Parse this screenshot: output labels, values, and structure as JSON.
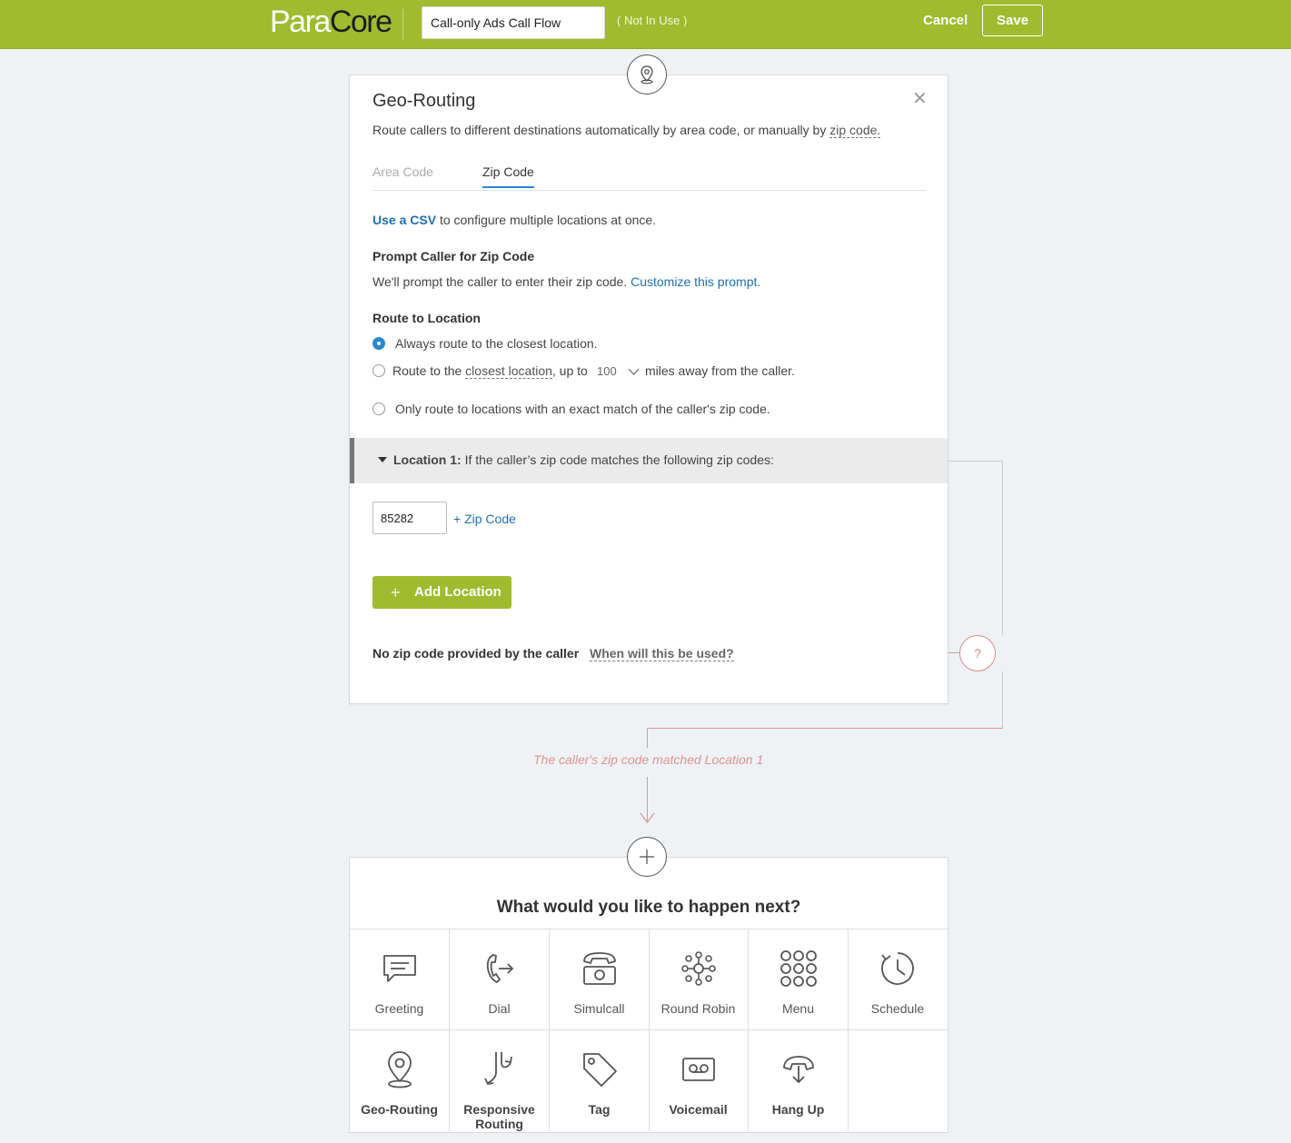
{
  "header": {
    "logo_light": "Para",
    "logo_dark": "Core",
    "flow_name": "Call-only Ads Call Flow",
    "status": "( Not In Use )",
    "cancel_label": "Cancel",
    "save_label": "Save"
  },
  "geo": {
    "title": "Geo-Routing",
    "subtitle_prefix": "Route callers to different destinations automatically by area code, or manually by",
    "subtitle_link": "zip code.",
    "tabs": {
      "area": "Area Code",
      "zip": "Zip Code"
    },
    "csv_link": "Use a CSV",
    "csv_rest": "to configure multiple locations at once.",
    "prompt_heading": "Prompt Caller for Zip Code",
    "prompt_text": "We'll prompt the caller to enter their zip code.",
    "prompt_link": "Customize this prompt.",
    "route_heading": "Route to Location",
    "option1": "Always route to the closest location.",
    "option2_a": "Route to the",
    "option2_link": "closest location",
    "option2_b": ", up to",
    "option2_miles": "100",
    "option2_c": "miles away from the caller.",
    "option3": "Only route to locations with an exact match of the caller's zip code.",
    "location_label": "Location 1:",
    "location_text": "If the caller’s zip code matches the following zip codes:",
    "zip_value": "85282",
    "add_zip": "Zip Code",
    "add_location": "Add Location",
    "no_zip": "No zip code provided by the caller",
    "when_used": "When will this be used?"
  },
  "connector": {
    "match_text": "The caller's zip code matched Location 1",
    "question": "?"
  },
  "next": {
    "title": "What would you like to happen next?",
    "actions": [
      {
        "label": "Greeting",
        "icon": "greeting-icon"
      },
      {
        "label": "Dial",
        "icon": "dial-icon"
      },
      {
        "label": "Simulcall",
        "icon": "simulcall-icon"
      },
      {
        "label": "Round Robin",
        "icon": "round-robin-icon"
      },
      {
        "label": "Menu",
        "icon": "menu-icon"
      },
      {
        "label": "Schedule",
        "icon": "schedule-icon"
      },
      {
        "label": "Geo-Routing",
        "icon": "geo-routing-icon"
      },
      {
        "label": "Responsive Routing",
        "icon": "responsive-routing-icon"
      },
      {
        "label": "Tag",
        "icon": "tag-icon"
      },
      {
        "label": "Voicemail",
        "icon": "voicemail-icon"
      },
      {
        "label": "Hang Up",
        "icon": "hang-up-icon"
      }
    ]
  },
  "colors": {
    "brand": "#a0bb2f",
    "link": "#1f6fb4",
    "accent_pink": "#d98b8b",
    "radio_on": "#2a86d6"
  }
}
